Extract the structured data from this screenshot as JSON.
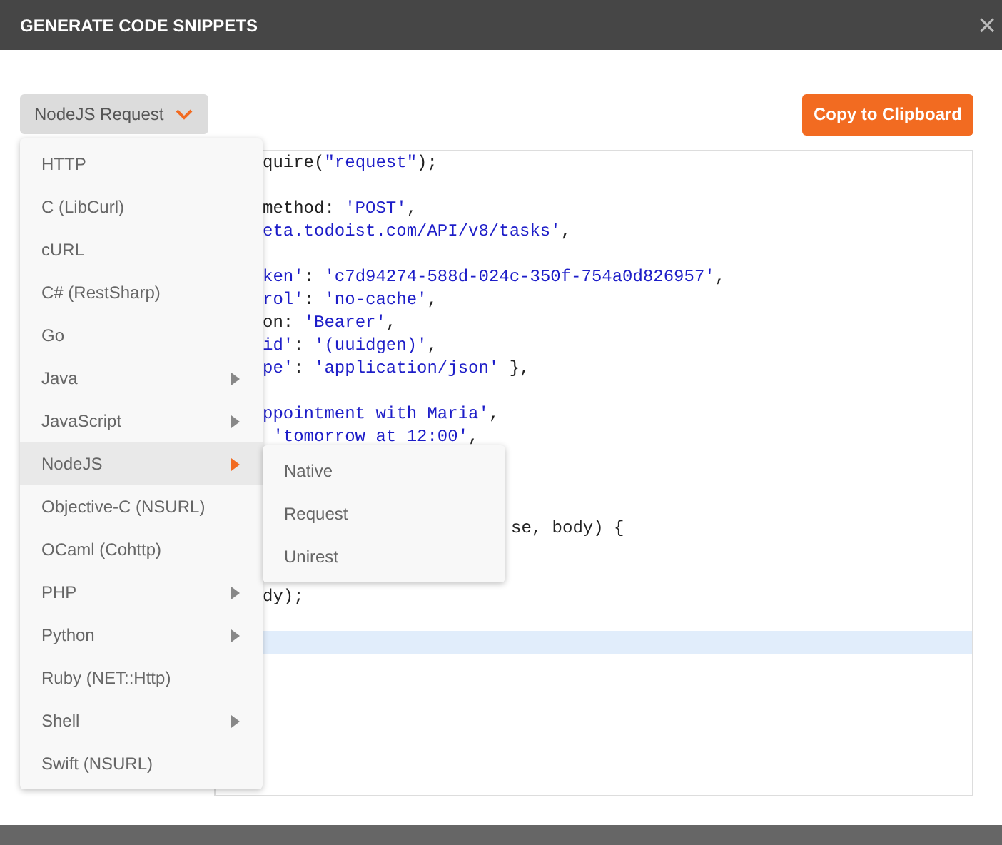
{
  "window": {
    "title": "GENERATE CODE SNIPPETS",
    "close": "×"
  },
  "language_select": {
    "value": "NodeJS Request"
  },
  "copy_button": "Copy to Clipboard",
  "menu": [
    {
      "label": "HTTP",
      "submenu": false,
      "selected": false
    },
    {
      "label": "C (LibCurl)",
      "submenu": false,
      "selected": false
    },
    {
      "label": "cURL",
      "submenu": false,
      "selected": false
    },
    {
      "label": "C# (RestSharp)",
      "submenu": false,
      "selected": false
    },
    {
      "label": "Go",
      "submenu": false,
      "selected": false
    },
    {
      "label": "Java",
      "submenu": true,
      "selected": false
    },
    {
      "label": "JavaScript",
      "submenu": true,
      "selected": false
    },
    {
      "label": "NodeJS",
      "submenu": true,
      "selected": true
    },
    {
      "label": "Objective-C (NSURL)",
      "submenu": false,
      "selected": false
    },
    {
      "label": "OCaml (Cohttp)",
      "submenu": false,
      "selected": false
    },
    {
      "label": "PHP",
      "submenu": true,
      "selected": false
    },
    {
      "label": "Python",
      "submenu": true,
      "selected": false
    },
    {
      "label": "Ruby (NET::Http)",
      "submenu": false,
      "selected": false
    },
    {
      "label": "Shell",
      "submenu": true,
      "selected": false
    },
    {
      "label": "Swift (NSURL)",
      "submenu": false,
      "selected": false
    }
  ],
  "submenu": [
    "Native",
    "Request",
    "Unirest"
  ],
  "code": [
    {
      "kind": "text",
      "parts": [
        {
          "text": "quire(",
          "kind": "plain"
        },
        {
          "text": "\"request\"",
          "kind": "string"
        },
        {
          "text": ");",
          "kind": "plain"
        }
      ]
    },
    {
      "kind": "blank"
    },
    {
      "kind": "text",
      "parts": [
        {
          "text": "method: ",
          "kind": "plain"
        },
        {
          "text": "'POST'",
          "kind": "string"
        },
        {
          "text": ",",
          "kind": "plain"
        }
      ]
    },
    {
      "kind": "text",
      "parts": [
        {
          "text": "eta.todoist.com/API/v8/tasks'",
          "kind": "string"
        },
        {
          "text": ",",
          "kind": "plain"
        }
      ]
    },
    {
      "kind": "blank"
    },
    {
      "kind": "text",
      "parts": [
        {
          "text": "ken'",
          "kind": "string"
        },
        {
          "text": ": ",
          "kind": "plain"
        },
        {
          "text": "'c7d94274-588d-024c-350f-754a0d826957'",
          "kind": "string"
        },
        {
          "text": ",",
          "kind": "plain"
        }
      ]
    },
    {
      "kind": "text",
      "parts": [
        {
          "text": "rol'",
          "kind": "string"
        },
        {
          "text": ": ",
          "kind": "plain"
        },
        {
          "text": "'no-cache'",
          "kind": "string"
        },
        {
          "text": ",",
          "kind": "plain"
        }
      ]
    },
    {
      "kind": "text",
      "parts": [
        {
          "text": "on: ",
          "kind": "plain"
        },
        {
          "text": "'Bearer'",
          "kind": "string"
        },
        {
          "text": ",",
          "kind": "plain"
        }
      ]
    },
    {
      "kind": "text",
      "parts": [
        {
          "text": "id'",
          "kind": "string"
        },
        {
          "text": ": ",
          "kind": "plain"
        },
        {
          "text": "'(uuidgen)'",
          "kind": "string"
        },
        {
          "text": ",",
          "kind": "plain"
        }
      ]
    },
    {
      "kind": "text",
      "parts": [
        {
          "text": "pe'",
          "kind": "string"
        },
        {
          "text": ": ",
          "kind": "plain"
        },
        {
          "text": "'application/json'",
          "kind": "string"
        },
        {
          "text": " },",
          "kind": "plain"
        }
      ]
    },
    {
      "kind": "blank"
    },
    {
      "kind": "text",
      "parts": [
        {
          "text": "ppointment with Maria'",
          "kind": "string"
        },
        {
          "text": ",",
          "kind": "plain"
        }
      ]
    },
    {
      "kind": "text",
      "parts": [
        {
          "text": " 'tomorrow at 12:00'",
          "kind": "string"
        },
        {
          "text": ",",
          "kind": "plain"
        }
      ]
    },
    {
      "kind": "blank"
    },
    {
      "kind": "blank"
    },
    {
      "kind": "blank"
    },
    {
      "kind": "tail",
      "parts": [
        {
          "text": "se, body) {",
          "kind": "plain"
        }
      ]
    },
    {
      "kind": "blank"
    },
    {
      "kind": "blank"
    },
    {
      "kind": "text",
      "parts": [
        {
          "text": "dy);",
          "kind": "plain"
        }
      ]
    },
    {
      "kind": "blank"
    },
    {
      "kind": "cursor"
    }
  ]
}
